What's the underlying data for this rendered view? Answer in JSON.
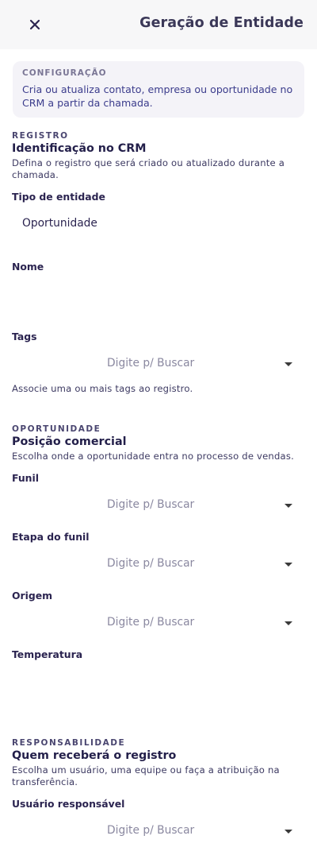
{
  "header": {
    "title": "Geração de Entidade",
    "close_icon": "close-icon"
  },
  "config": {
    "label": "CONFIGURAÇÃO",
    "description": "Cria ou atualiza contato, empresa ou oportunidade no CRM a partir da chamada."
  },
  "registro": {
    "kicker": "REGISTRO",
    "title": "Identificação no CRM",
    "description": "Defina o registro que será criado ou atualizado durante a chamada.",
    "tipo_label": "Tipo de entidade",
    "tipo_value": "Oportunidade",
    "nome_label": "Nome",
    "nome_value": "",
    "tags_label": "Tags",
    "tags_placeholder": "Digite p/ Buscar",
    "tags_helper": "Associe uma ou mais tags ao registro."
  },
  "oportunidade": {
    "kicker": "OPORTUNIDADE",
    "title": "Posição comercial",
    "description": "Escolha onde a oportunidade entra no processo de vendas.",
    "funil_label": "Funil",
    "funil_placeholder": "Digite p/ Buscar",
    "etapa_label": "Etapa do funil",
    "etapa_placeholder": "Digite p/ Buscar",
    "origem_label": "Origem",
    "origem_placeholder": "Digite p/ Buscar",
    "temperatura_label": "Temperatura",
    "temperatura_value": ""
  },
  "responsabilidade": {
    "kicker": "RESPONSABILIDADE",
    "title": "Quem receberá o registro",
    "description": "Escolha um usuário, uma equipe ou faça a atribuição na transferência.",
    "usuario_label": "Usuário responsável",
    "usuario_placeholder": "Digite p/ Buscar"
  }
}
